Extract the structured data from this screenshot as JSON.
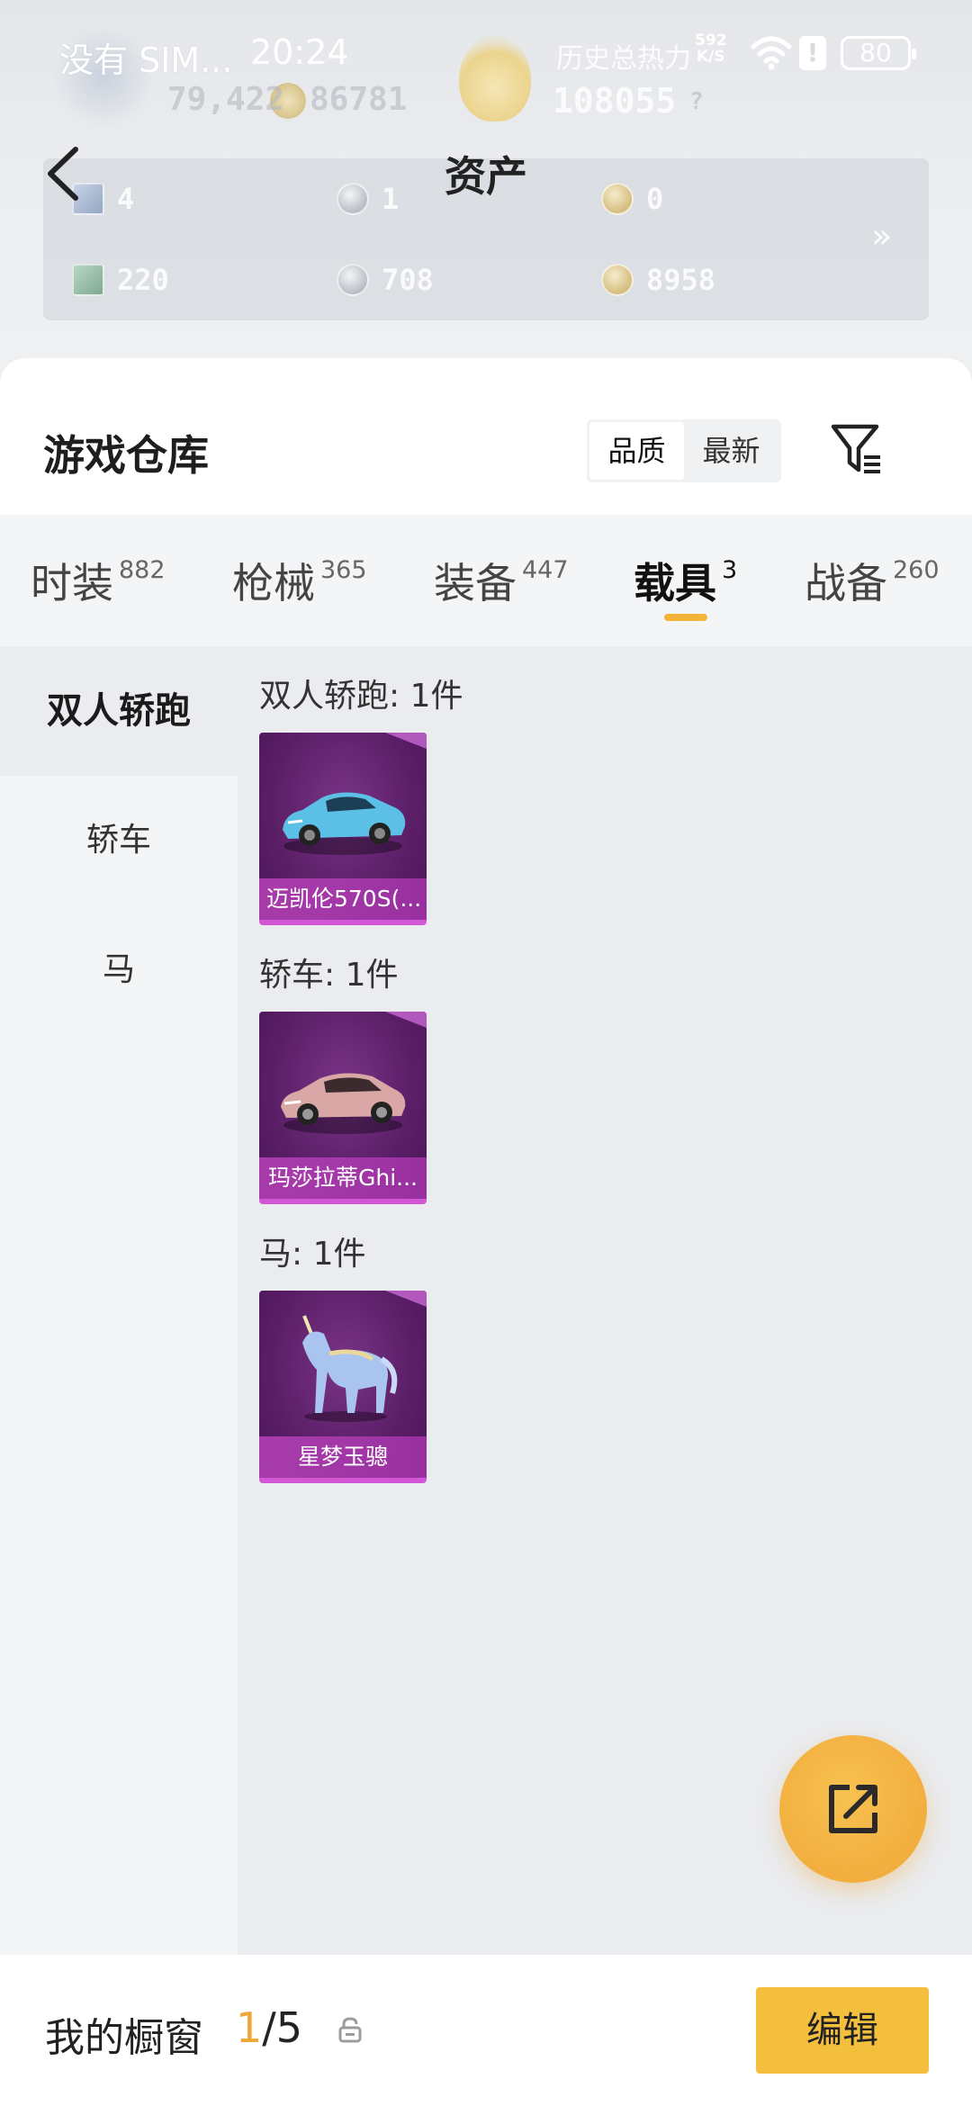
{
  "status_bar": {
    "carrier": "没有 SIM...",
    "time": "20:24",
    "speed_value": "592",
    "speed_unit": "K/S",
    "battery": "80"
  },
  "hero": {
    "history_heat_label": "历史总热力",
    "stat_1": "79,422",
    "stat_2": "86781",
    "heat_value": "108055"
  },
  "header": {
    "title": "资产"
  },
  "assets": [
    {
      "icon": "card-coin-icon",
      "value": "4"
    },
    {
      "icon": "silver-coin-icon",
      "value": "1"
    },
    {
      "icon": "gold-coin-icon",
      "value": "0"
    },
    {
      "icon": "ticket-icon",
      "value": "220"
    },
    {
      "icon": "bp-coin-icon",
      "value": "708"
    },
    {
      "icon": "shield-coin-icon",
      "value": "8958"
    }
  ],
  "warehouse": {
    "title": "游戏仓库",
    "sort_options": [
      "品质",
      "最新"
    ],
    "sort_selected": "品质"
  },
  "tabs": [
    {
      "label": "时装",
      "count": "882"
    },
    {
      "label": "枪械",
      "count": "365"
    },
    {
      "label": "装备",
      "count": "447"
    },
    {
      "label": "载具",
      "count": "3"
    },
    {
      "label": "战备",
      "count": "260"
    }
  ],
  "active_tab": "载具",
  "sidebar": {
    "items": [
      "双人轿跑",
      "轿车",
      "马"
    ],
    "active": "双人轿跑"
  },
  "groups": [
    {
      "title": "双人轿跑: 1件",
      "items": [
        {
          "name": "迈凯伦570S(...",
          "art": "sports-car-icon"
        }
      ]
    },
    {
      "title": "轿车: 1件",
      "items": [
        {
          "name": "玛莎拉蒂Ghi...",
          "art": "sedan-icon"
        }
      ]
    },
    {
      "title": "马: 1件",
      "items": [
        {
          "name": "星梦玉骢",
          "art": "unicorn-icon"
        }
      ]
    }
  ],
  "bottom_bar": {
    "showcase_label": "我的橱窗",
    "showcase_current": "1",
    "showcase_total": "/5",
    "edit_label": "编辑"
  },
  "colors": {
    "accent": "#f4bf3d",
    "indicator": "#f2b53a",
    "card_purple": "#5a1e66",
    "card_border": "#d257d4"
  }
}
